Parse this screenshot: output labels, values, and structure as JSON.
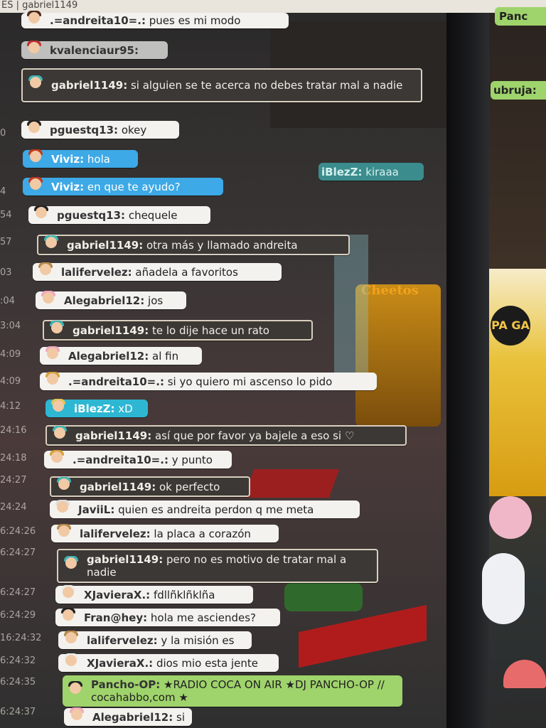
{
  "top_strip": {
    "text": "ES | gabriel1149"
  },
  "colors": {
    "bubble_white": "#f3f2ef",
    "bubble_blue": "#3da9e6",
    "bubble_framed": "#3b3835",
    "bubble_green": "#9fd36b",
    "bubble_teal": "#3b8c8d"
  },
  "timestamps": [
    "0",
    "4",
    "54",
    "57",
    "03",
    ":04",
    "3:04",
    "4:09",
    "4:09",
    "4:12",
    "24:16",
    "24:18",
    "24:27",
    "24:24",
    "6:24:26",
    "6:24:27",
    "6:24:27",
    "6:24:29",
    "16:24:32",
    "6:24:32",
    "6:24:35",
    "6:24:37"
  ],
  "chat": [
    {
      "name": ".=andreita10=.:",
      "text": "pues es mi modo",
      "style": "white"
    },
    {
      "name": "kvalenciaur95:",
      "text": "",
      "style": "gray"
    },
    {
      "name": "gabriel1149:",
      "text": "si alguien se te acerca no debes tratar mal a nadie",
      "style": "framed-tall"
    },
    {
      "name": "pguestq13:",
      "text": "okey",
      "style": "white"
    },
    {
      "name": "Viviz:",
      "text": "hola",
      "style": "blue"
    },
    {
      "name": "Viviz:",
      "text": "en que te ayudo?",
      "style": "blue"
    },
    {
      "name": "pguestq13:",
      "text": "chequele",
      "style": "white"
    },
    {
      "name": "gabriel1149:",
      "text": "otra más y llamado andreita",
      "style": "framed"
    },
    {
      "name": "lalifervelez:",
      "text": "añadela a favoritos",
      "style": "white"
    },
    {
      "name": "Alegabriel12:",
      "text": "jos",
      "style": "white"
    },
    {
      "name": "gabriel1149:",
      "text": "te lo dije hace un rato",
      "style": "framed"
    },
    {
      "name": "Alegabriel12:",
      "text": "al fin",
      "style": "white"
    },
    {
      "name": ".=andreita10=.:",
      "text": "si yo quiero mi ascenso lo pido",
      "style": "white"
    },
    {
      "name": "iBlezZ:",
      "text": "xD",
      "style": "cyan"
    },
    {
      "name": "gabriel1149:",
      "text": "así que por favor ya bajele a eso si ♡",
      "style": "framed"
    },
    {
      "name": ".=andreita10=.:",
      "text": "y punto",
      "style": "white"
    },
    {
      "name": "gabriel1149:",
      "text": "ok perfecto",
      "style": "framed"
    },
    {
      "name": "JaviiL:",
      "text": "quien es andreita perdon q me meta",
      "style": "white"
    },
    {
      "name": "lalifervelez:",
      "text": "la placa a corazón",
      "style": "white"
    },
    {
      "name": "gabriel1149:",
      "text": "pero no es motivo de tratar mal a nadie",
      "style": "framed-tall"
    },
    {
      "name": "XJavieraX.:",
      "text": "fdllñklñklña",
      "style": "white"
    },
    {
      "name": "Fran@hey:",
      "text": "hola me asciendes?",
      "style": "white"
    },
    {
      "name": "lalifervelez:",
      "text": "y la misión es",
      "style": "white"
    },
    {
      "name": "XJavieraX.:",
      "text": "dios mio esta jente",
      "style": "white"
    },
    {
      "name": "Pancho-OP:",
      "text": "★RADIO COCA ON AIR ★DJ PANCHO-OP // cocahabbo,com ★",
      "style": "green"
    },
    {
      "name": "Alegabriel12:",
      "text": "si",
      "style": "white"
    }
  ],
  "room_bubble": {
    "name": "iBlezZ:",
    "text": "kiraaa"
  },
  "right_bubbles": [
    {
      "text": "Panc"
    },
    {
      "text": "ubruja:"
    }
  ],
  "room_signs": {
    "cheetos": "Cheetos",
    "shop": "PA GA"
  }
}
